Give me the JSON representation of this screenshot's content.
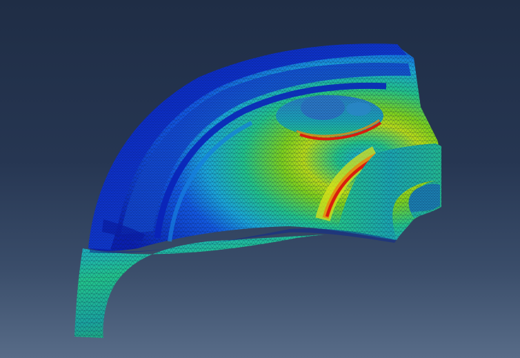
{
  "viewport": {
    "background_top": "#1f2d45",
    "background_bottom": "#586c88"
  },
  "model": {
    "name": "fem-mesh-part",
    "contour_colormap": [
      "#0a1fb0",
      "#1258e0",
      "#1aa6d8",
      "#22c48a",
      "#7ed21c",
      "#d8e21a",
      "#e58a10",
      "#d81e0e"
    ],
    "mesh_type": "triangular",
    "mesh_line_color": "#0b1640"
  }
}
